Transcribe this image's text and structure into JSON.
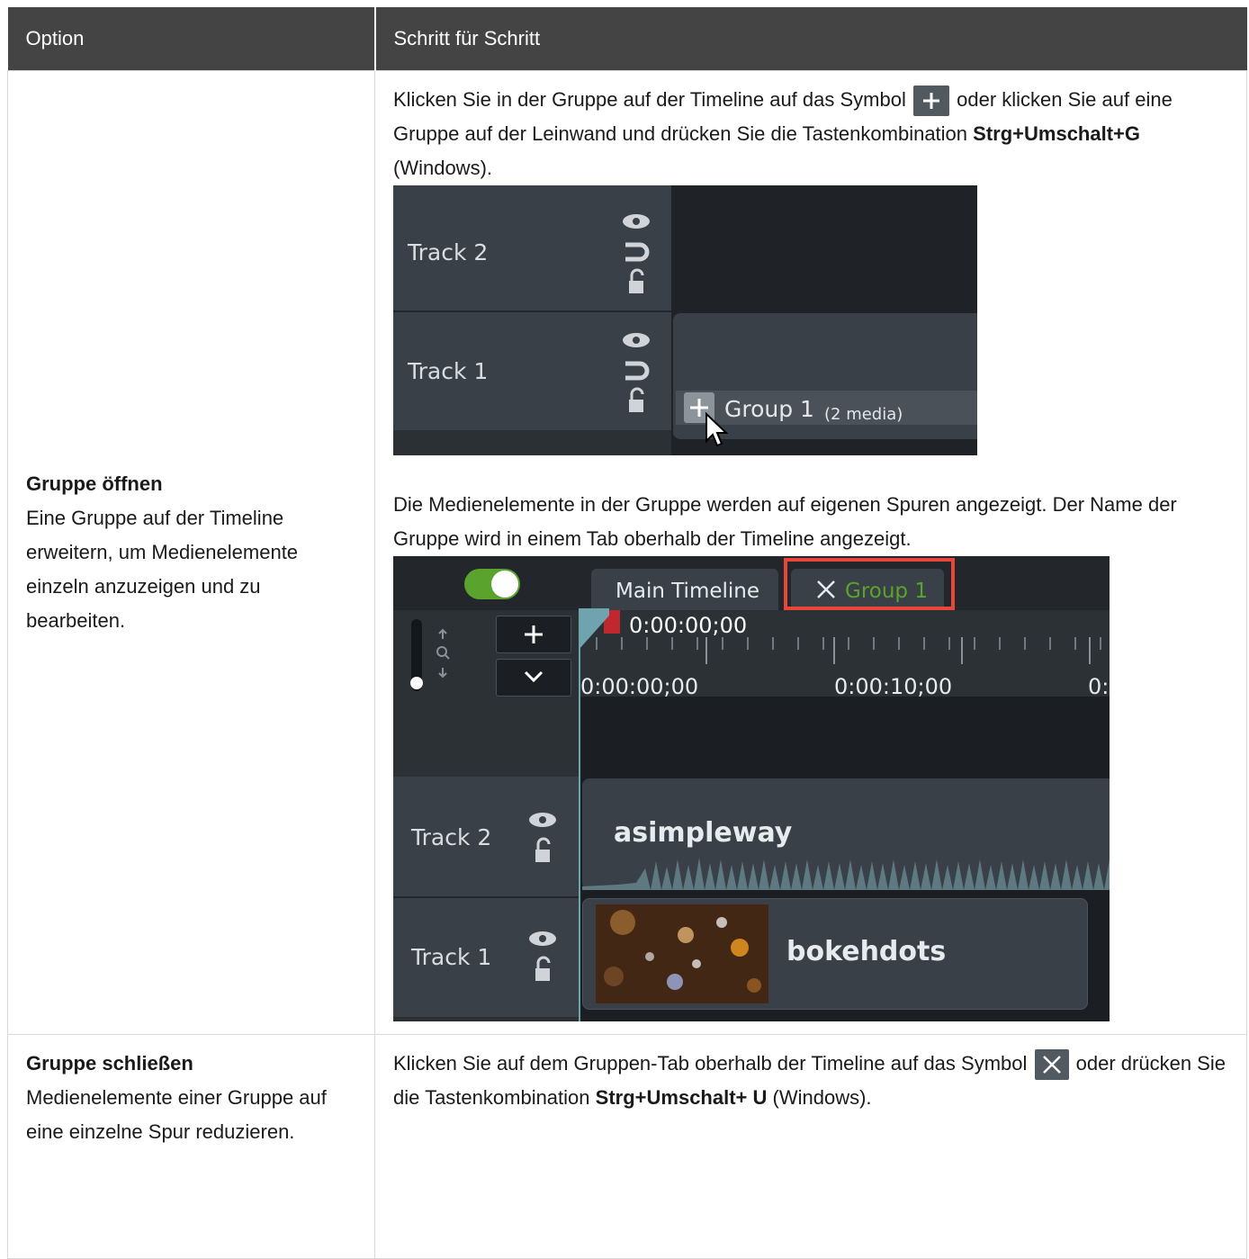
{
  "table": {
    "headers": [
      "Option",
      "Schritt für Schritt"
    ],
    "rows": [
      {
        "title": "Gruppe öffnen",
        "description": "Eine Gruppe auf der Timeline erweitern, um Medienelemente einzeln anzuzeigen und zu bearbeiten.",
        "step1": {
          "before_icon": "Klicken Sie in der Gruppe auf der Timeline auf das Symbol",
          "icon": "plus-icon",
          "after_icon": "oder klicken Sie auf eine Gruppe auf der Leinwand und drücken Sie die Tastenkombination",
          "shortcut": "Strg+Umschalt+G",
          "suffix": "(Windows)."
        },
        "screenshot1": {
          "track2": "Track 2",
          "track1": "Track 1",
          "group_label": "Group 1",
          "group_count": "(2 media)"
        },
        "step2": "Die Medienelemente in der Gruppe werden auf eigenen Spuren angezeigt. Der Name der Gruppe wird in einem Tab oberhalb der Timeline angezeigt.",
        "screenshot2": {
          "tab_main": "Main Timeline",
          "tab_group": "Group 1",
          "playhead_time": "0:00:00;00",
          "ruler_labels": [
            "0:00:00;00",
            "0:00:10;00",
            "0:"
          ],
          "track2": "Track 2",
          "track1": "Track 1",
          "clip_audio": "asimpleway",
          "clip_video": "bokehdots",
          "highlight_color": "#e8463a",
          "toggle_color": "#5aa32c"
        }
      },
      {
        "title": "Gruppe schließen",
        "description": "Medienelemente einer Gruppe auf eine einzelne Spur reduzieren.",
        "step1": {
          "before_icon": "Klicken Sie auf dem Gruppen-Tab oberhalb der Timeline auf das Symbol",
          "icon": "close-icon",
          "after_icon": "oder drücken Sie die Tastenkombination",
          "shortcut": "Strg+Umschalt+ U",
          "suffix": "(Windows)."
        }
      }
    ]
  }
}
